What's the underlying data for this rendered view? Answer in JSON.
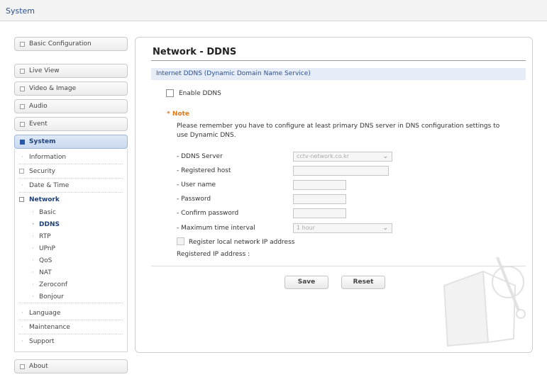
{
  "header": {
    "title": "System"
  },
  "sidebar": {
    "top_buttons": [
      "Basic Configuration",
      "Live View",
      "Video & Image",
      "Audio",
      "Event",
      "System"
    ],
    "system_items": {
      "information": "Information",
      "security": "Security",
      "date_time": "Date & Time",
      "network": "Network",
      "network_sub": [
        "Basic",
        "DDNS",
        "RTP",
        "UPnP",
        "QoS",
        "NAT",
        "Zeroconf",
        "Bonjour"
      ],
      "language": "Language",
      "maintenance": "Maintenance",
      "support": "Support"
    },
    "about": "About",
    "selected": "DDNS"
  },
  "main": {
    "title": "Network - DDNS",
    "section": "Internet DDNS (Dynamic Domain Name Service)",
    "enable_label": "Enable DDNS",
    "enable_checked": false,
    "note_title": "* Note",
    "note_text": "Please remember you have to configure at least primary DNS server in DNS configuration settings to use Dynamic DNS.",
    "form": {
      "ddns_server_label": "- DDNS Server",
      "ddns_server_value": "cctv-network.co.kr",
      "registered_host_label": "- Registered host",
      "user_name_label": "- User name",
      "password_label": "- Password",
      "confirm_password_label": "- Confirm password",
      "max_interval_label": "- Maximum time interval",
      "max_interval_value": "1 hour",
      "register_local_label": "Register local network IP address",
      "registered_ip_label": "Registered IP address :"
    },
    "buttons": {
      "save": "Save",
      "reset": "Reset"
    }
  }
}
